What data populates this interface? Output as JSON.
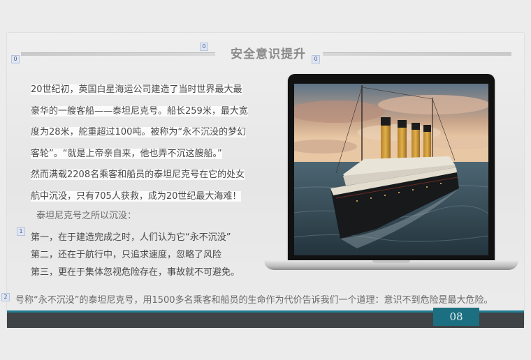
{
  "slide": {
    "title": "安全意识提升",
    "tags": {
      "title_left": "0",
      "title_mid": "0",
      "title_right": "0",
      "reasons": "1",
      "conclusion": "2"
    },
    "paragraph_lines": [
      "20世纪初，英国白星海运公司建造了当时世界最大最",
      "豪华的一艘客船——泰坦尼克号。船长259米，最大宽",
      "度为28米，舵重超过100吨。被称为“永不沉没的梦幻",
      "客轮”。“就是上帝亲自来，他也弄不沉这艘船。”",
      "然而满载2208名乘客和船员的泰坦尼克号在它的处女",
      "航中沉没，只有705人获救，成为20世纪最大海难！"
    ],
    "reasons_heading": "泰坦尼克号之所以沉没：",
    "reasons": [
      "第一，在于建造完成之时，人们认为它“永不沉没”",
      "第二，还在于航行中，只追求速度，忽略了风险",
      "第三，更在于集体忽视危险存在，事故就不可避免。"
    ],
    "conclusion": "号称“永不沉没”的泰坦尼克号，用1500多名乘客和船员的生命作为代价告诉我们一个道理：意识不到危险是最大危险。",
    "page_number": "08",
    "image": "laptop-showing-titanic-ship-photo"
  },
  "colors": {
    "accent": "#1c6f80",
    "footer": "#3f4345",
    "title": "#8a8a8a"
  }
}
